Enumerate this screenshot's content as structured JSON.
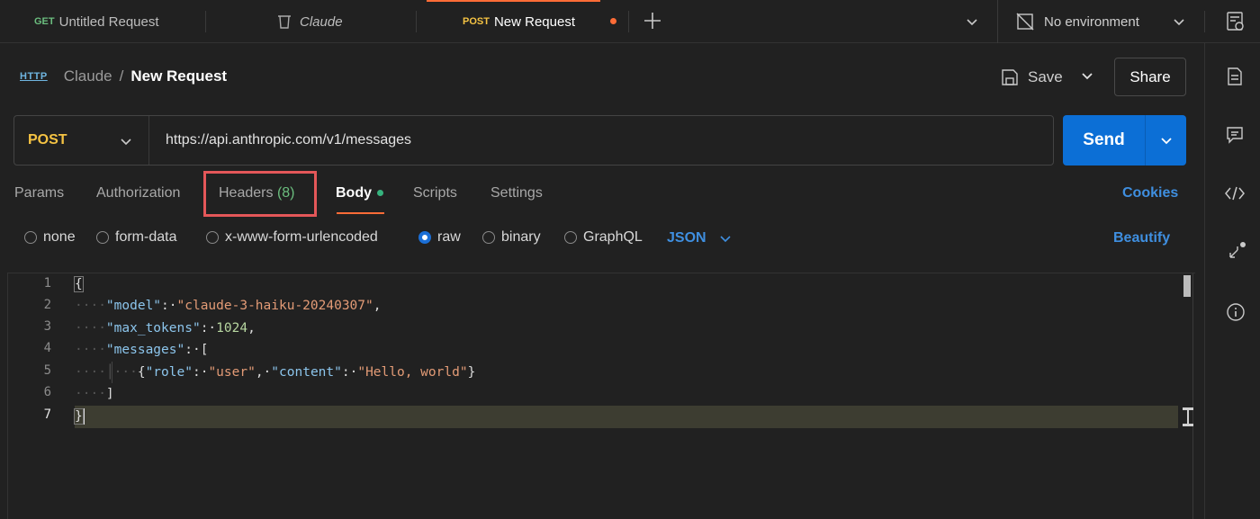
{
  "tabs": [
    {
      "method": "GET",
      "label": "Untitled Request"
    },
    {
      "label": "Claude"
    },
    {
      "method": "POST",
      "label": "New Request",
      "unsaved": true
    }
  ],
  "environment": {
    "label": "No environment"
  },
  "breadcrumb": {
    "icon": "HTTP",
    "parent": "Claude",
    "separator": "/",
    "current": "New Request"
  },
  "actions": {
    "save_label": "Save",
    "share_label": "Share"
  },
  "request": {
    "method": "POST",
    "url": "https://api.anthropic.com/v1/messages",
    "send_label": "Send"
  },
  "request_tabs": {
    "params": "Params",
    "authorization": "Authorization",
    "headers": "Headers",
    "headers_count": "(8)",
    "body": "Body",
    "scripts": "Scripts",
    "settings": "Settings",
    "cookies": "Cookies"
  },
  "body_options": {
    "none": "none",
    "form_data": "form-data",
    "urlencoded": "x-www-form-urlencoded",
    "raw": "raw",
    "binary": "binary",
    "graphql": "GraphQL",
    "format": "JSON",
    "beautify": "Beautify",
    "selected": "raw"
  },
  "editor": {
    "line_numbers": [
      "1",
      "2",
      "3",
      "4",
      "5",
      "6",
      "7"
    ],
    "current_line": "7",
    "tokens": {
      "open_brace": "{",
      "close_brace": "}",
      "model_key": "\"model\"",
      "model_val": "\"claude-3-haiku-20240307\"",
      "max_tokens_key": "\"max_tokens\"",
      "max_tokens_val": "1024",
      "messages_key": "\"messages\"",
      "open_bracket": "[",
      "close_bracket": "]",
      "role_key": "\"role\"",
      "role_val": "\"user\"",
      "content_key": "\"content\"",
      "content_val": "\"Hello, world\""
    }
  },
  "colors": {
    "accent": "#ff6c37",
    "primary": "#0c6fd6",
    "post": "#f5c343",
    "get": "#6bbd7e",
    "highlight": "#e45759"
  }
}
